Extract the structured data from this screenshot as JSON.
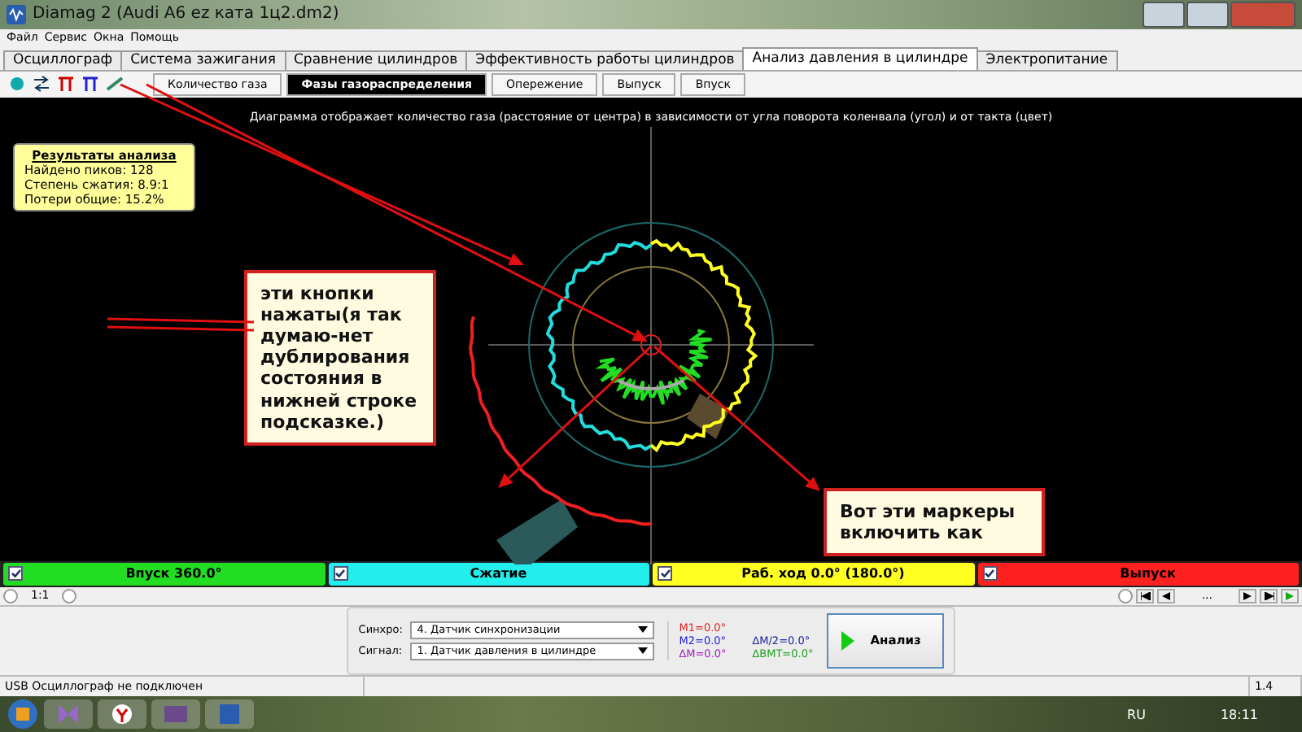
{
  "window": {
    "title": "Diamag 2 (Audi A6 ez ката 1ц2.dm2)"
  },
  "menu": [
    "Файл",
    "Сервис",
    "Окна",
    "Помощь"
  ],
  "tabs": [
    {
      "label": "Осциллограф",
      "selected": false
    },
    {
      "label": "Система зажигания",
      "selected": false
    },
    {
      "label": "Сравнение цилиндров",
      "selected": false
    },
    {
      "label": "Эффективность работы цилиндров",
      "selected": false
    },
    {
      "label": "Анализ давления в цилиндре",
      "selected": true
    },
    {
      "label": "Электропитание",
      "selected": false
    }
  ],
  "subtabs": [
    {
      "label": "Количество газа",
      "selected": false
    },
    {
      "label": "Фазы газораспределения",
      "selected": true
    },
    {
      "label": "Опережение",
      "selected": false
    },
    {
      "label": "Выпуск",
      "selected": false
    },
    {
      "label": "Впуск",
      "selected": false
    }
  ],
  "caption": "Диаграмма отображает количество газа (расстояние от центра) в зависимости от угла поворота коленвала (угол) и от такта (цвет)",
  "results": {
    "title": "Результаты анализа",
    "lines": [
      "Найдено пиков: 128",
      "Степень сжатия: 8.9:1",
      "Потери общие: 15.2%"
    ]
  },
  "notes": [
    "эти кнопки нажаты(я так думаю-нет дублирования состояния в нижней строке подсказке.)",
    "Вот эти маркеры включить как"
  ],
  "phases": [
    {
      "label": "Впуск 360.0°",
      "checked": true,
      "color": "#22dd22"
    },
    {
      "label": "Сжатие",
      "checked": true,
      "color": "#22eeee"
    },
    {
      "label": "Раб. ход 0.0° (180.0°)",
      "checked": true,
      "color": "#ffff22"
    },
    {
      "label": "Выпуск",
      "checked": true,
      "color": "#ff2020"
    }
  ],
  "zoom": "1:1",
  "pager": "...",
  "selectors": [
    {
      "label": "Синхро:",
      "value": "4.  Датчик синхронизации"
    },
    {
      "label": "Сигнал:",
      "value": "1.  Датчик давления в цилиндре"
    }
  ],
  "markers": [
    {
      "text": "M1=0.0°",
      "color": "#e02020"
    },
    {
      "text": "M2=0.0°",
      "color": "#2020e0"
    },
    {
      "text": "∆M/2=0.0°",
      "color": "#2020a0"
    },
    {
      "text": "∆M=0.0°",
      "color": "#a020c0"
    },
    {
      "text": "∆BMT=0.0°",
      "color": "#20a020"
    }
  ],
  "analyze": "Анализ",
  "status_bar": [
    "USB Осциллограф не подключен",
    "1.4"
  ],
  "taskbar": {
    "language": "RU",
    "time": "18:11"
  }
}
